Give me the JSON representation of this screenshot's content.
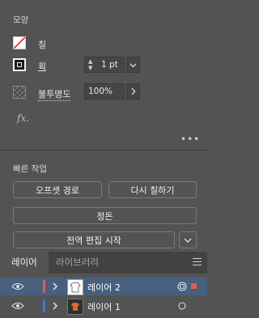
{
  "appearance": {
    "title": "모양",
    "fill_label": "칠",
    "stroke_label": "획",
    "stroke_weight": "1 pt",
    "opacity_label": "불투명도",
    "opacity_value": "100%",
    "fx_label": "fx."
  },
  "quick_actions": {
    "title": "빠른 작업",
    "offset_path": "오프셋 경로",
    "recolor": "다시 칠하기",
    "arrange": "정돈",
    "start_global_edit": "전역 편집 시작"
  },
  "tabs": [
    "레이어",
    "라이브러리"
  ],
  "layers": [
    {
      "name": "레이어 2",
      "color": "#e05a5a",
      "selected": true
    },
    {
      "name": "레이어 1",
      "color": "#4a6fd6",
      "selected": false
    }
  ],
  "colors": {
    "panel_bg": "#535353",
    "selected_row": "#46607e",
    "layer2_accent": "#e05a5a",
    "layer1_accent": "#4a6fd6"
  }
}
